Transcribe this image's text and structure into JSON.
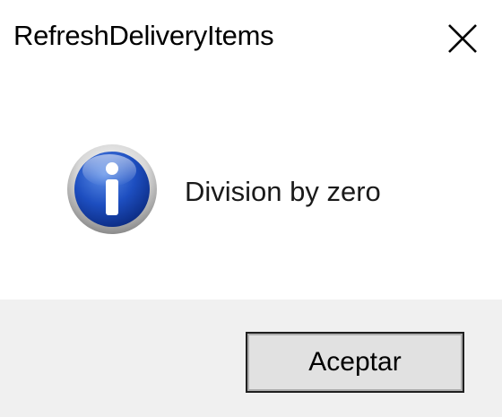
{
  "window": {
    "title": "RefreshDeliveryItems",
    "close_icon": "close-icon"
  },
  "content": {
    "icon": "info-icon",
    "message": "Division by zero"
  },
  "footer": {
    "ok_label": "Aceptar"
  },
  "colors": {
    "footer_background": "#f0f0f0",
    "button_background": "#e1e1e1",
    "icon_blue": "#1a46b8"
  }
}
